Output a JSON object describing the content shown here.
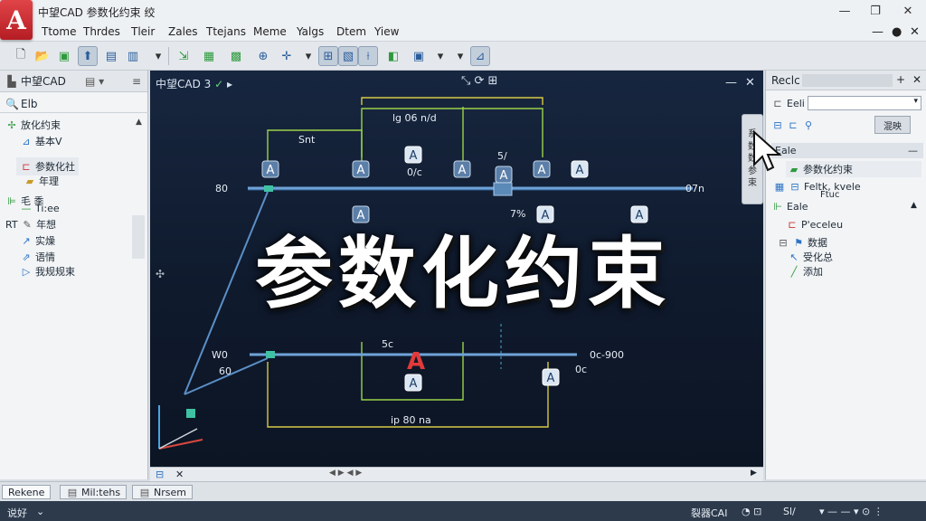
{
  "app": {
    "logo_letter": "A",
    "title": "中望CAD 参数化约束 绞"
  },
  "menu": [
    "Ttome",
    "Thrdes",
    "Tleir",
    "Zales",
    "Ttejans",
    "Meme",
    "Yalgs",
    "Dtem",
    "Yiew"
  ],
  "left_panel": {
    "header": "中望CAD",
    "section": "Elb",
    "items": [
      "放化约束",
      "基本V",
      "参数化社",
      "年理",
      "毛 季",
      "Ti:ee",
      "年想",
      "实燥",
      "语情",
      "我规规束"
    ],
    "prefix_rt": "RT"
  },
  "drawing": {
    "tab": "中望CAD 3",
    "dims": {
      "top": "lg 06 n/d",
      "left": "Snt",
      "bottom": "ip 80 na",
      "mid1": "0/c",
      "mid2": "7%",
      "mid3": "5/",
      "lower1": "5c",
      "lower2": "0c",
      "right_lbl1": "07n",
      "right_lbl2": "0c-900",
      "left_lbl1": "80",
      "left_lbl2": "W0",
      "left_lbl3": "60"
    },
    "constraint_letter": "A"
  },
  "overlay_title": "参数化约束",
  "side_tab": [
    "系",
    "数",
    "数",
    "参",
    "束"
  ],
  "right_panel": {
    "header": "Reclc",
    "search_label": "Eeli",
    "btn": "混映",
    "section1": "Eale",
    "item1": "参数化约束",
    "item2": "Feltk, kvele",
    "item3": "Ftuc",
    "section2": "Eale",
    "sub": [
      "P'eceleu",
      "数据",
      "受化总",
      "添加"
    ]
  },
  "bottom_tabs": [
    "Rekene",
    "Mil:tehs",
    "Nrsem"
  ],
  "status": {
    "left": "说好",
    "right1": "裂器CAI",
    "right2": "Sl/"
  }
}
